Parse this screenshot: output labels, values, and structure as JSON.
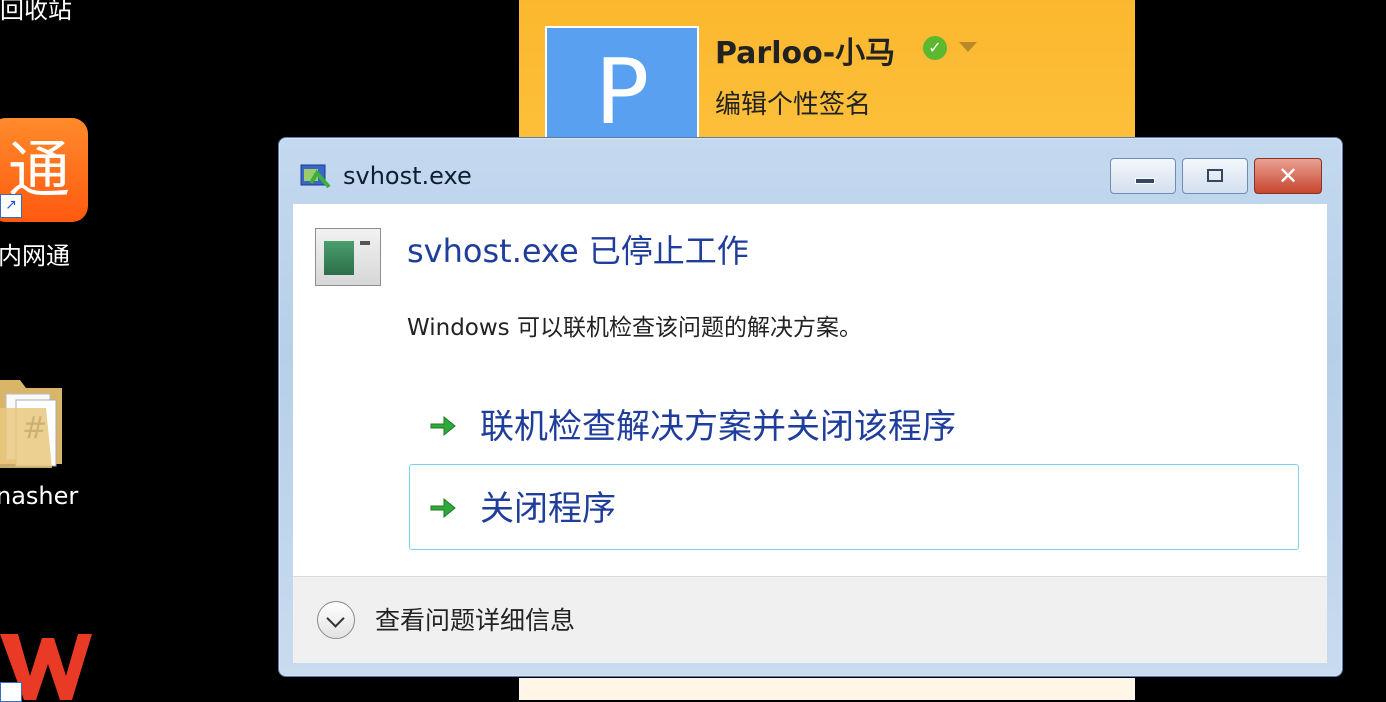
{
  "desktop": {
    "items": [
      {
        "label": "回收站"
      },
      {
        "label": "内网通",
        "icon_text": "通"
      },
      {
        "label": "nasher"
      },
      {
        "label": "WPS"
      }
    ]
  },
  "qq_panel": {
    "avatar_letter": "P",
    "nickname": "Parloo-小马",
    "signature": "编辑个性签名"
  },
  "dialog": {
    "title": "svhost.exe",
    "heading": "svhost.exe 已停止工作",
    "description": "Windows 可以联机检查该问题的解决方案。",
    "commands": [
      {
        "label": "联机检查解决方案并关闭该程序"
      },
      {
        "label": "关闭程序"
      }
    ],
    "details_toggle": "查看问题详细信息",
    "close_glyph": "✕"
  },
  "colors": {
    "heading": "#1f3d9b",
    "panel_bg": "#fbb82f",
    "accent_arrow": "#2faa3a"
  },
  "icons": [
    "minimize-icon",
    "maximize-icon",
    "close-icon",
    "green-arrow-icon",
    "chevron-down-icon"
  ]
}
